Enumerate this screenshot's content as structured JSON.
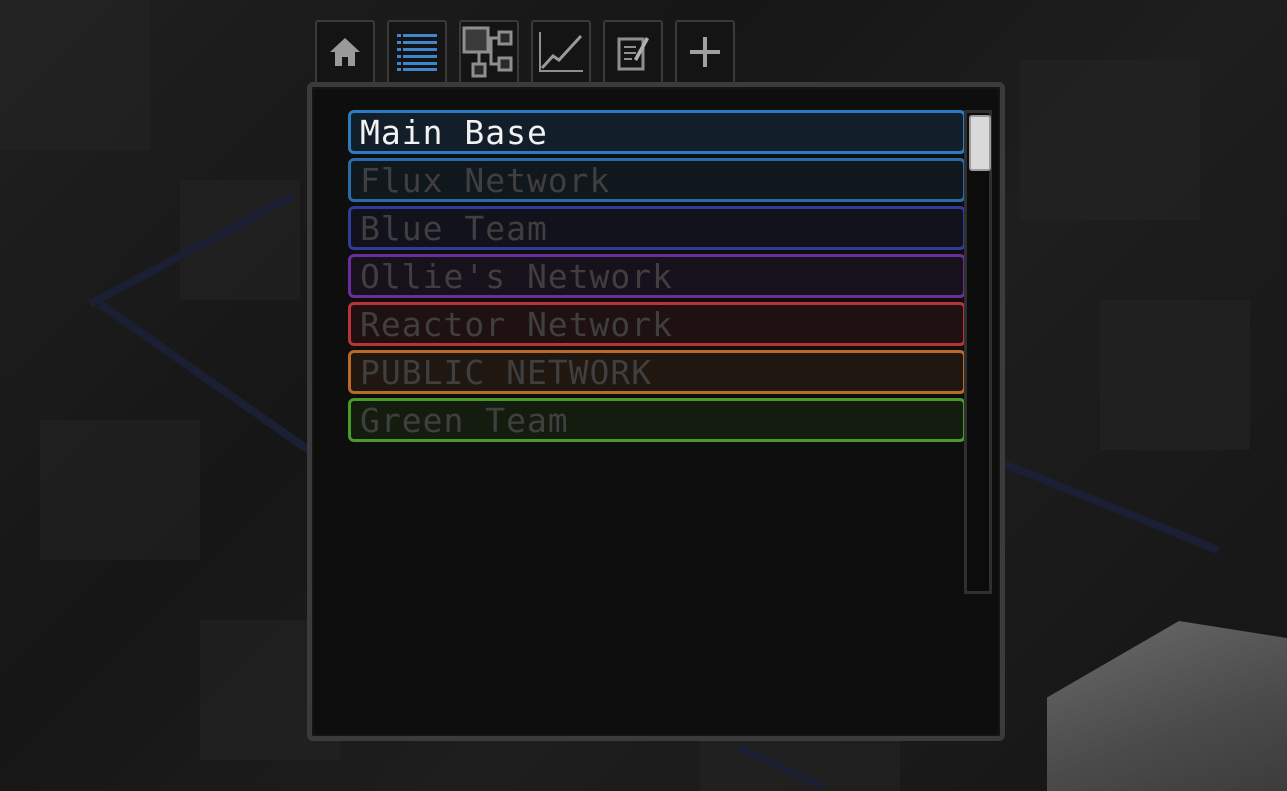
{
  "tabs": [
    {
      "name": "tab-home",
      "icon": "home-icon"
    },
    {
      "name": "tab-network-list",
      "icon": "list-icon",
      "active": true
    },
    {
      "name": "tab-connections",
      "icon": "connections-icon"
    },
    {
      "name": "tab-statistics",
      "icon": "line-chart-icon"
    },
    {
      "name": "tab-edit",
      "icon": "edit-icon"
    },
    {
      "name": "tab-create",
      "icon": "plus-icon"
    }
  ],
  "networks": [
    {
      "label": "Main Base",
      "color": "#2e7bc0",
      "selected": true
    },
    {
      "label": "Flux Network",
      "color": "#2a6aa8",
      "selected": false
    },
    {
      "label": "Blue Team",
      "color": "#323a9a",
      "selected": false
    },
    {
      "label": "Ollie's Network",
      "color": "#6a2e9a",
      "selected": false
    },
    {
      "label": "Reactor Network",
      "color": "#b8333a",
      "selected": false
    },
    {
      "label": "PUBLIC NETWORK",
      "color": "#b86a2a",
      "selected": false
    },
    {
      "label": "Green Team",
      "color": "#4a9a2a",
      "selected": false
    }
  ],
  "colors": {
    "accent_blue": "#2e7bc0",
    "panel_bg": "#0e0e0e",
    "panel_border": "#3b3b3b"
  }
}
